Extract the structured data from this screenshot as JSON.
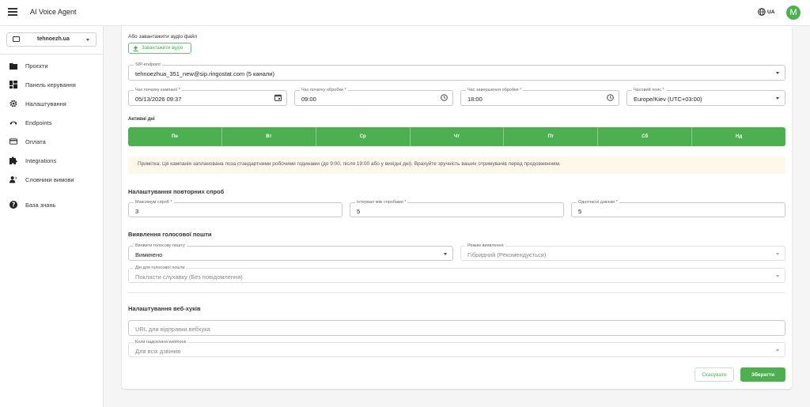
{
  "app": {
    "title": "AI Voice Agent",
    "lang": "UA",
    "avatar_letter": "M"
  },
  "sidebar": {
    "project": "tehnoezh.ua",
    "items": [
      {
        "label": "Проєкти",
        "icon": "folder-icon"
      },
      {
        "label": "Панель керування",
        "icon": "dashboard-icon"
      },
      {
        "label": "Налаштування",
        "icon": "gear-icon"
      },
      {
        "label": "Endpoints",
        "icon": "phone-icon"
      },
      {
        "label": "Оплата",
        "icon": "credit-card-icon"
      },
      {
        "label": "Integrations",
        "icon": "puzzle-icon"
      },
      {
        "label": "Словники вимови",
        "icon": "voice-icon"
      },
      {
        "label": "База знань",
        "icon": "help-icon"
      }
    ]
  },
  "form": {
    "upload_heading": "Або завантажити аудіо файл",
    "upload_button": "Завантажити аудіо",
    "sip": {
      "label": "SIP-endpoint",
      "value": "tehnoezhua_351_new@sip.ringostat.com (5 канали)"
    },
    "campaign_start": {
      "label": "Час початку кампанії *",
      "value": "05/13/2026 09:37"
    },
    "proc_start": {
      "label": "Час початку обробки *",
      "value": "09:00"
    },
    "proc_end": {
      "label": "Час завершення обробки *",
      "value": "18:00"
    },
    "timezone": {
      "label": "Часовий пояс *",
      "value": "Europe/Kiev (UTC+03:00)"
    },
    "active_days_label": "Активні дні",
    "days": [
      "Пн",
      "Вт",
      "Ср",
      "Чт",
      "Пт",
      "Сб",
      "Нд"
    ],
    "note": "Примітка: Ця кампанія запланована поза стандартними робочими годинами (до 9:00, після 19:00 або у вихідні дні). Врахуйте зручність ваших отримувачів перед продовженням.",
    "retry_title": "Налаштування повторних спроб",
    "max_attempts": {
      "label": "Максимум спроб *",
      "value": "3"
    },
    "interval": {
      "label": "Інтервал між спробами *",
      "value": "5"
    },
    "concurrent": {
      "label": "Одночасні дзвінки *",
      "value": "5"
    },
    "voicemail_title": "Виявлення голосової пошти",
    "vm_detect": {
      "label": "Виявити голосову пошту",
      "value": "Вимкнено"
    },
    "vm_mode": {
      "label": "Режим виявлення",
      "value": "Гібридний (Рекомендується)"
    },
    "vm_action": {
      "label": "Дія для голосової пошти",
      "value": "Покласти слухавку (Без повідомлення)"
    },
    "webhook_title": "Налаштування веб-хуків",
    "webhook_url": {
      "placeholder": "URL для відправки вебхука"
    },
    "webhook_when": {
      "label": "Коли надсилати webhook",
      "value": "Для всіх дзвінків"
    },
    "cancel": "Скасувати",
    "save": "Зберегти"
  },
  "colors": {
    "accent": "#4caf50",
    "note_bg": "#fdf8ea"
  }
}
